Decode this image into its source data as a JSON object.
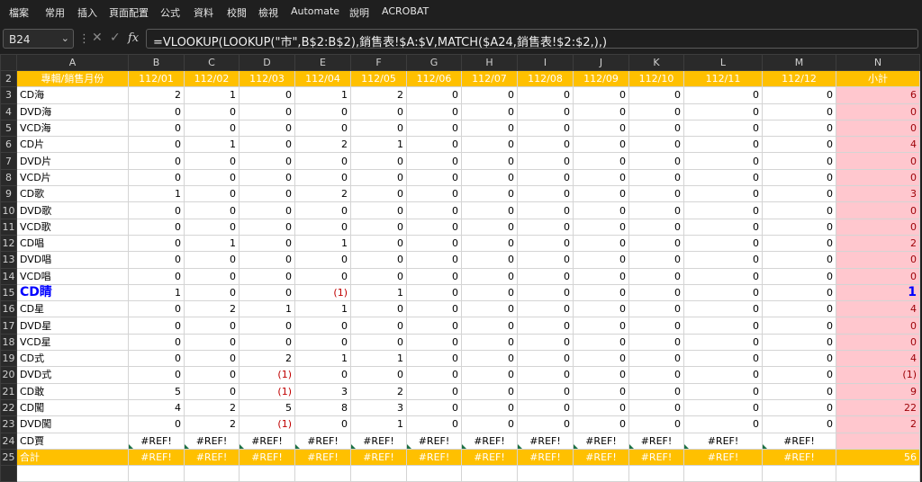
{
  "menu": [
    "檔案",
    "常用",
    "插入",
    "頁面配置",
    "公式",
    "資料",
    "校閱",
    "檢視",
    "Automate",
    "說明",
    "ACROBAT"
  ],
  "name_box": "B24",
  "formula_icons": [
    "cancel-icon",
    "enter-icon",
    "fx-icon"
  ],
  "formula": "=VLOOKUP(LOOKUP(\"市\",B$2:B$2),銷售表!$A:$V,MATCH($A24,銷售表!$2:$2,),)",
  "columns": [
    "A",
    "B",
    "C",
    "D",
    "E",
    "F",
    "G",
    "H",
    "I",
    "J",
    "K",
    "L",
    "M",
    "N"
  ],
  "row2": [
    "專輯/銷售月份",
    "112/01",
    "112/02",
    "112/03",
    "112/04",
    "112/05",
    "112/06",
    "112/07",
    "112/08",
    "112/09",
    "112/10",
    "112/11",
    "112/12",
    "小計"
  ],
  "rows": [
    {
      "n": "3",
      "label": "CD海",
      "vals": [
        "2",
        "1",
        "0",
        "1",
        "2",
        "0",
        "0",
        "0",
        "0",
        "0",
        "0",
        "0"
      ],
      "total": "6"
    },
    {
      "n": "4",
      "label": "DVD海",
      "vals": [
        "0",
        "0",
        "0",
        "0",
        "0",
        "0",
        "0",
        "0",
        "0",
        "0",
        "0",
        "0"
      ],
      "total": "0"
    },
    {
      "n": "5",
      "label": "VCD海",
      "vals": [
        "0",
        "0",
        "0",
        "0",
        "0",
        "0",
        "0",
        "0",
        "0",
        "0",
        "0",
        "0"
      ],
      "total": "0"
    },
    {
      "n": "6",
      "label": "CD片",
      "vals": [
        "0",
        "1",
        "0",
        "2",
        "1",
        "0",
        "0",
        "0",
        "0",
        "0",
        "0",
        "0"
      ],
      "total": "4"
    },
    {
      "n": "7",
      "label": "DVD片",
      "vals": [
        "0",
        "0",
        "0",
        "0",
        "0",
        "0",
        "0",
        "0",
        "0",
        "0",
        "0",
        "0"
      ],
      "total": "0"
    },
    {
      "n": "8",
      "label": "VCD片",
      "vals": [
        "0",
        "0",
        "0",
        "0",
        "0",
        "0",
        "0",
        "0",
        "0",
        "0",
        "0",
        "0"
      ],
      "total": "0"
    },
    {
      "n": "9",
      "label": "CD歌",
      "vals": [
        "1",
        "0",
        "0",
        "2",
        "0",
        "0",
        "0",
        "0",
        "0",
        "0",
        "0",
        "0"
      ],
      "total": "3"
    },
    {
      "n": "10",
      "label": "DVD歌",
      "vals": [
        "0",
        "0",
        "0",
        "0",
        "0",
        "0",
        "0",
        "0",
        "0",
        "0",
        "0",
        "0"
      ],
      "total": "0"
    },
    {
      "n": "11",
      "label": "VCD歌",
      "vals": [
        "0",
        "0",
        "0",
        "0",
        "0",
        "0",
        "0",
        "0",
        "0",
        "0",
        "0",
        "0"
      ],
      "total": "0"
    },
    {
      "n": "12",
      "label": "CD唱",
      "vals": [
        "0",
        "1",
        "0",
        "1",
        "0",
        "0",
        "0",
        "0",
        "0",
        "0",
        "0",
        "0"
      ],
      "total": "2"
    },
    {
      "n": "13",
      "label": "DVD唱",
      "vals": [
        "0",
        "0",
        "0",
        "0",
        "0",
        "0",
        "0",
        "0",
        "0",
        "0",
        "0",
        "0"
      ],
      "total": "0"
    },
    {
      "n": "14",
      "label": "VCD唱",
      "vals": [
        "0",
        "0",
        "0",
        "0",
        "0",
        "0",
        "0",
        "0",
        "0",
        "0",
        "0",
        "0"
      ],
      "total": "0"
    },
    {
      "n": "15",
      "label": "CD睛",
      "vals": [
        "1",
        "0",
        "0",
        "(1)",
        "1",
        "0",
        "0",
        "0",
        "0",
        "0",
        "0",
        "0"
      ],
      "total": "1",
      "blue": true
    },
    {
      "n": "16",
      "label": "CD星",
      "vals": [
        "0",
        "2",
        "1",
        "1",
        "0",
        "0",
        "0",
        "0",
        "0",
        "0",
        "0",
        "0"
      ],
      "total": "4"
    },
    {
      "n": "17",
      "label": "DVD星",
      "vals": [
        "0",
        "0",
        "0",
        "0",
        "0",
        "0",
        "0",
        "0",
        "0",
        "0",
        "0",
        "0"
      ],
      "total": "0"
    },
    {
      "n": "18",
      "label": "VCD星",
      "vals": [
        "0",
        "0",
        "0",
        "0",
        "0",
        "0",
        "0",
        "0",
        "0",
        "0",
        "0",
        "0"
      ],
      "total": "0"
    },
    {
      "n": "19",
      "label": "CD式",
      "vals": [
        "0",
        "0",
        "2",
        "1",
        "1",
        "0",
        "0",
        "0",
        "0",
        "0",
        "0",
        "0"
      ],
      "total": "4"
    },
    {
      "n": "20",
      "label": "DVD式",
      "vals": [
        "0",
        "0",
        "(1)",
        "0",
        "0",
        "0",
        "0",
        "0",
        "0",
        "0",
        "0",
        "0"
      ],
      "total": "(1)"
    },
    {
      "n": "21",
      "label": "CD敢",
      "vals": [
        "5",
        "0",
        "(1)",
        "3",
        "2",
        "0",
        "0",
        "0",
        "0",
        "0",
        "0",
        "0"
      ],
      "total": "9"
    },
    {
      "n": "22",
      "label": "CD闖",
      "vals": [
        "4",
        "2",
        "5",
        "8",
        "3",
        "0",
        "0",
        "0",
        "0",
        "0",
        "0",
        "0"
      ],
      "total": "22"
    },
    {
      "n": "23",
      "label": "DVD闖",
      "vals": [
        "0",
        "2",
        "(1)",
        "0",
        "1",
        "0",
        "0",
        "0",
        "0",
        "0",
        "0",
        "0"
      ],
      "total": "2"
    }
  ],
  "row24": {
    "n": "24",
    "label": "CD賈",
    "vals": [
      "#REF!",
      "#REF!",
      "#REF!",
      "#REF!",
      "#REF!",
      "#REF!",
      "#REF!",
      "#REF!",
      "#REF!",
      "#REF!",
      "#REF!",
      "#REF!"
    ],
    "total": ""
  },
  "row25": {
    "n": "25",
    "label": "合計",
    "vals": [
      "#REF!",
      "#REF!",
      "#REF!",
      "#REF!",
      "#REF!",
      "#REF!",
      "#REF!",
      "#REF!",
      "#REF!",
      "#REF!",
      "#REF!",
      "#REF!"
    ],
    "total": "56"
  },
  "colors": {
    "gold": "#ffc000",
    "pink_fill": "#ffc7ce",
    "pink_text": "#9c0006",
    "negative": "#c00000",
    "highlight": "#0000ff"
  }
}
